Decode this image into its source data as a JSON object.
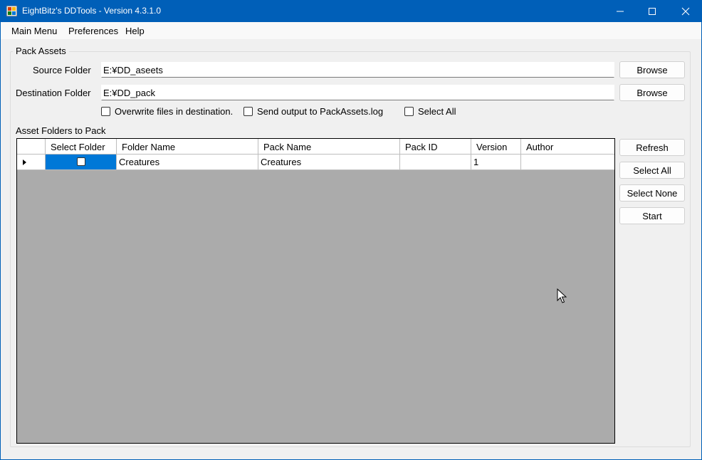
{
  "window": {
    "title": "EightBitz's DDTools - Version 4.3.1.0"
  },
  "menu": {
    "items": [
      "Main Menu",
      "Preferences",
      "Help"
    ]
  },
  "pack_assets": {
    "group_title": "Pack Assets",
    "source_label": "Source Folder",
    "source_value": "E:¥DD_aseets",
    "destination_label": "Destination Folder",
    "destination_value": "E:¥DD_pack",
    "browse_label": "Browse",
    "options": {
      "overwrite": {
        "label": "Overwrite files in destination.",
        "checked": false
      },
      "send_output": {
        "label": "Send output to PackAssets.log",
        "checked": false
      },
      "select_all": {
        "label": "Select All",
        "checked": false
      }
    }
  },
  "asset_folders": {
    "label": "Asset Folders to Pack",
    "columns": [
      "Select Folder",
      "Folder Name",
      "Pack Name",
      "Pack ID",
      "Version",
      "Author"
    ],
    "rows": [
      {
        "select_folder": false,
        "folder_name": "Creatures",
        "pack_name": "Creatures",
        "pack_id": "",
        "version": "1",
        "author": ""
      }
    ]
  },
  "actions": {
    "refresh": "Refresh",
    "select_all": "Select All",
    "select_none": "Select None",
    "start": "Start"
  },
  "colors": {
    "title_bar": "#005fb8",
    "selection": "#0078d7",
    "grid_background": "#ababab"
  }
}
